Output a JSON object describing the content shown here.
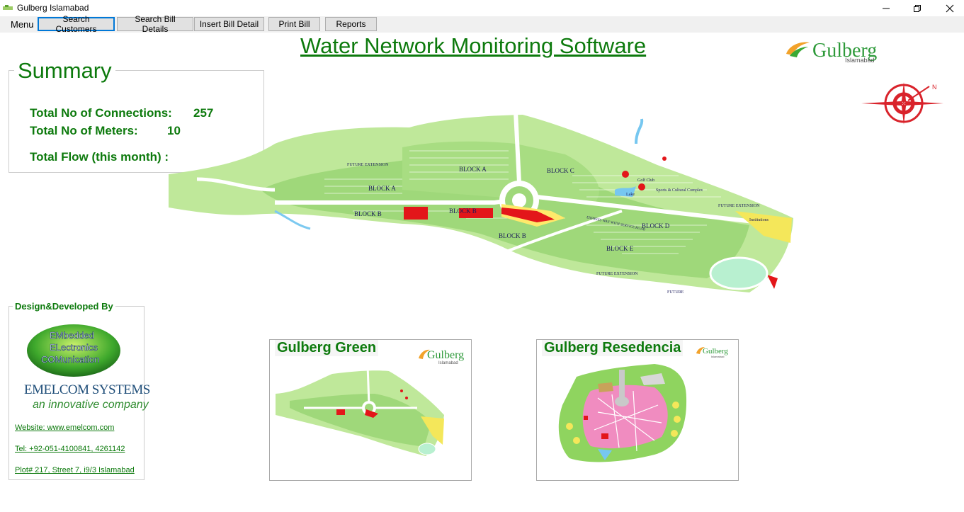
{
  "window": {
    "title": "Gulberg Islamabad"
  },
  "toolbar": {
    "menu_label": "Menu",
    "buttons": [
      {
        "label": "Search Customers",
        "selected": true
      },
      {
        "label": "Search Bill Details",
        "selected": false
      },
      {
        "label": "Insert Bill Detail",
        "selected": false
      },
      {
        "label": "Print Bill",
        "selected": false
      },
      {
        "label": "Reports",
        "selected": false
      }
    ]
  },
  "header": {
    "title": "Water Network Monitoring Software",
    "logo_text": "Gulberg",
    "logo_subtext": "Islamabad"
  },
  "summary": {
    "title": "Summary",
    "connections_label": "Total No of Connections:",
    "connections_value": "257",
    "meters_label": "Total No of Meters:",
    "meters_value": "10",
    "flow_label": "Total Flow (this month) :"
  },
  "map": {
    "labels": [
      "BLOCK A",
      "BLOCK A",
      "BLOCK B",
      "BLOCK B",
      "BLOCK B",
      "BLOCK C",
      "BLOCK D",
      "BLOCK E",
      "FUTURE EXTENSION",
      "FUTURE EXTENSION",
      "FUTURE EXTENSION",
      "FUTURE",
      "Lake",
      "Golf Club",
      "Sports & Cultural Complex",
      "Institutions",
      "EXPRESS WAY WITH SERVICE ROAD"
    ]
  },
  "developer": {
    "title": "Design&Developed By",
    "logo_lines": [
      "EMbedded",
      "ELectronics",
      "COMunication"
    ],
    "company_name": "EMELCOM SYSTEMS",
    "tagline": "an innovative company",
    "website": "Website: www.emelcom.com",
    "phone": "Tel: +92-051-4100841, 4261142",
    "address": "Plot# 217, Street 7, i9/3 Islamabad"
  },
  "cards": [
    {
      "title": "Gulberg Green",
      "logo_text": "Gulberg",
      "logo_subtext": "Islamabad"
    },
    {
      "title": "Gulberg Resedencia",
      "logo_text": "Gulberg",
      "logo_subtext": "Islamabad"
    }
  ],
  "colors": {
    "brand_green": "#0d7a0d",
    "map_green": "#8fd45f",
    "logo_red": "#d9232b"
  }
}
